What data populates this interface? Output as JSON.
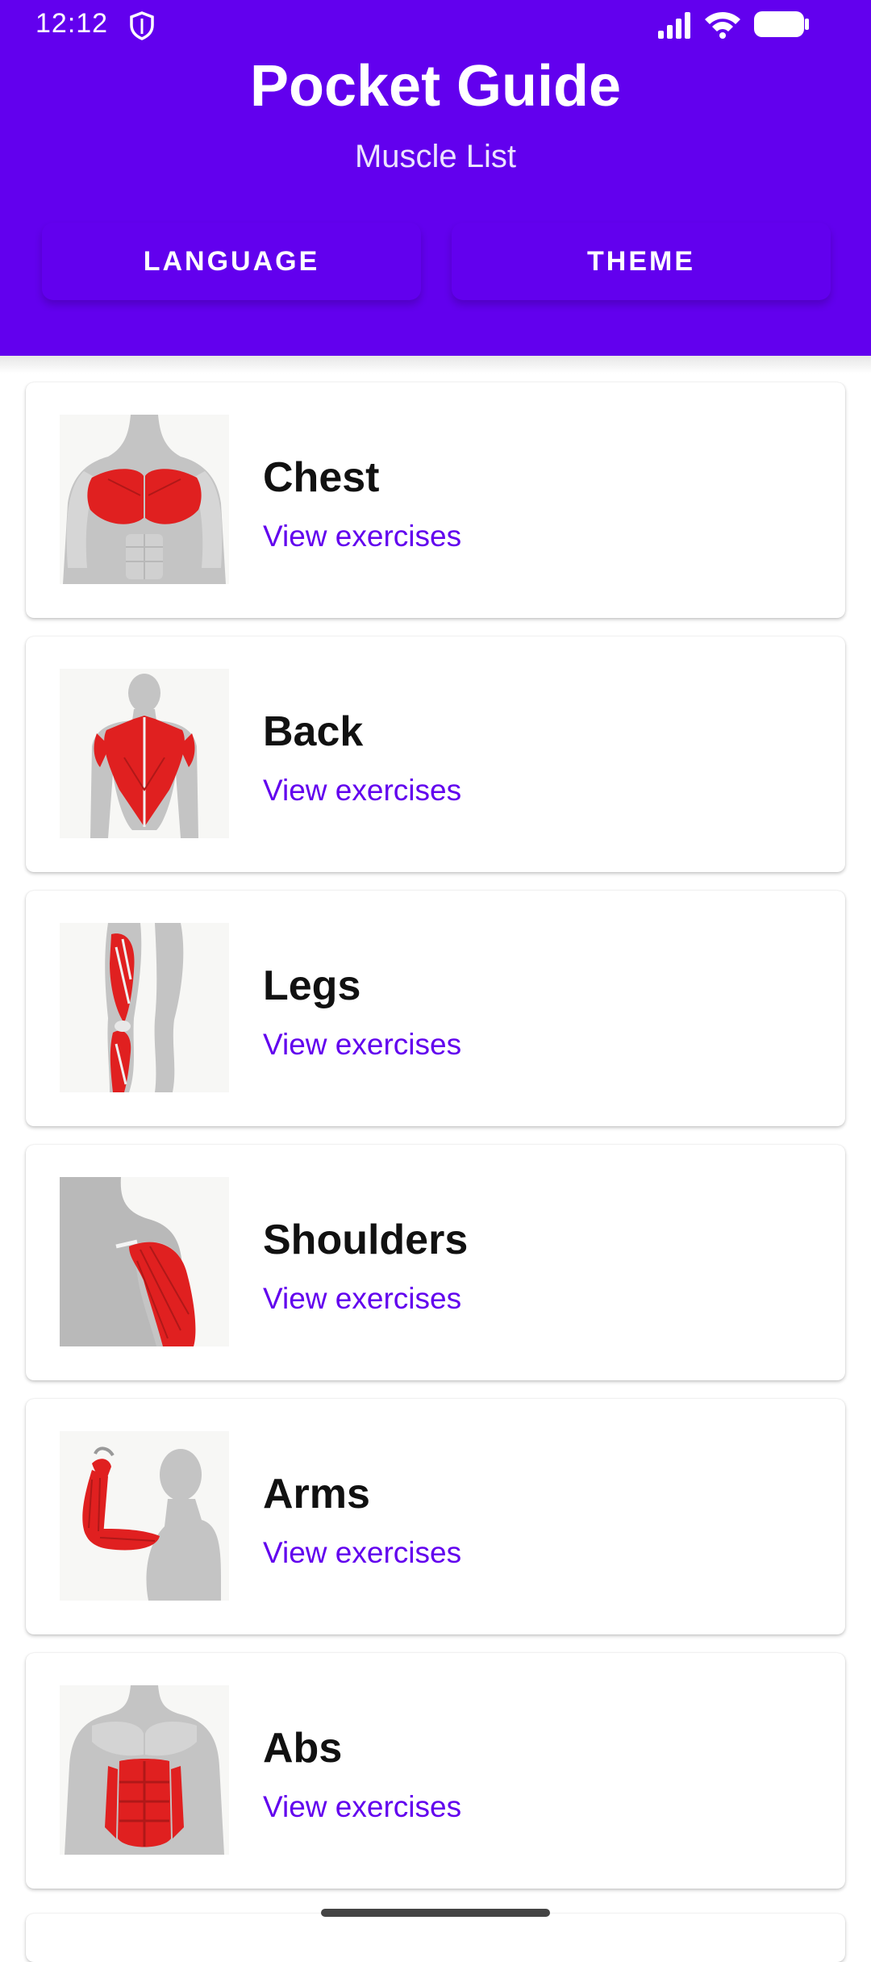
{
  "status_bar": {
    "time": "12:12",
    "icons": [
      "shield-icon",
      "signal-icon",
      "wifi-icon",
      "battery-icon"
    ]
  },
  "header": {
    "title": "Pocket Guide",
    "subtitle": "Muscle List",
    "buttons": {
      "language": "LANGUAGE",
      "theme": "THEME"
    }
  },
  "colors": {
    "primary": "#6200EE",
    "muscle_red": "#E02020",
    "body_gray": "#BDBDBD"
  },
  "muscles": [
    {
      "name": "Chest",
      "link": "View exercises",
      "image": "chest-illustration"
    },
    {
      "name": "Back",
      "link": "View exercises",
      "image": "back-illustration"
    },
    {
      "name": "Legs",
      "link": "View exercises",
      "image": "legs-illustration"
    },
    {
      "name": "Shoulders",
      "link": "View exercises",
      "image": "shoulders-illustration"
    },
    {
      "name": "Arms",
      "link": "View exercises",
      "image": "arms-illustration"
    },
    {
      "name": "Abs",
      "link": "View exercises",
      "image": "abs-illustration"
    }
  ]
}
